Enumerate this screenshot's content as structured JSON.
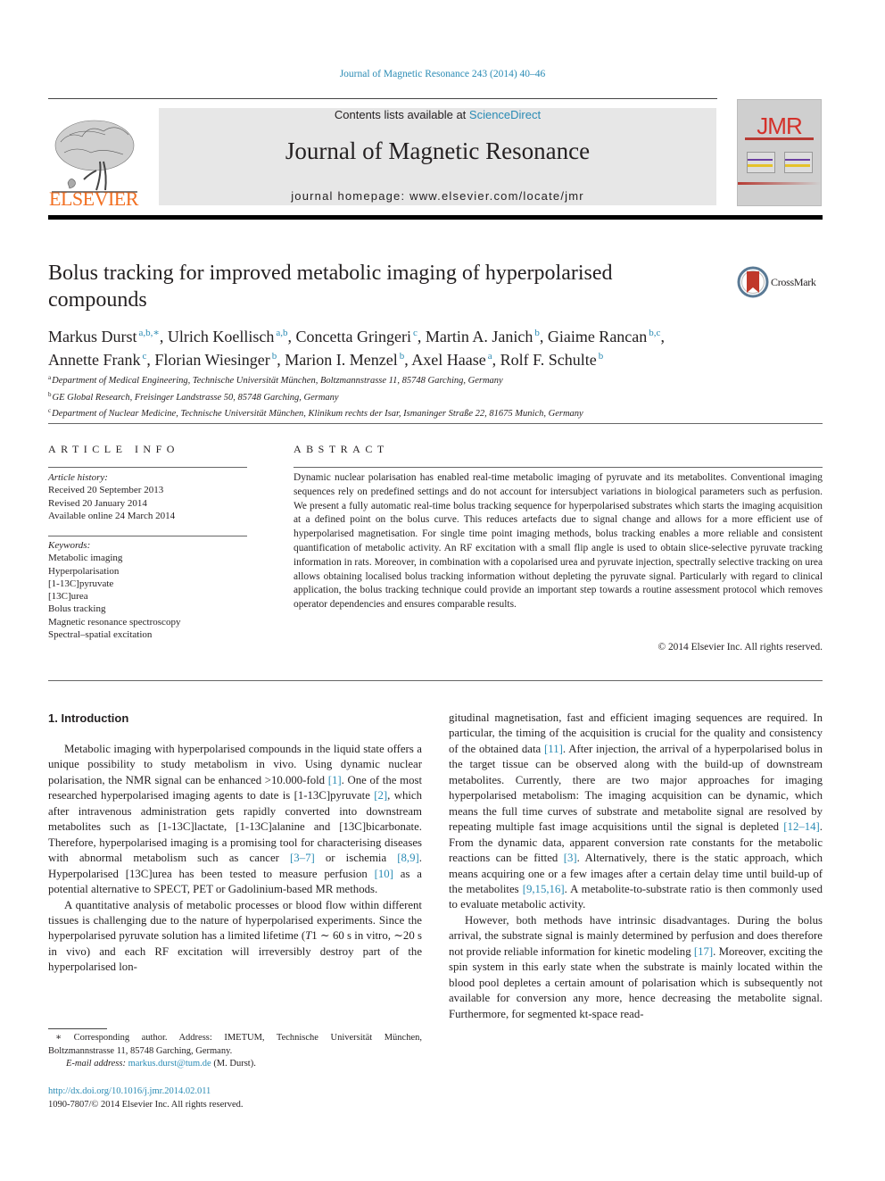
{
  "header": {
    "journal_reference": "Journal of Magnetic Resonance 243 (2014) 40–46",
    "publisher_logo_text": "ELSEVIER",
    "contents_prefix": "Contents lists available at ",
    "contents_link": "ScienceDirect",
    "journal_name": "Journal of Magnetic Resonance",
    "homepage": "journal homepage: www.elsevier.com/locate/jmr",
    "cover_title": "JMR",
    "colors": {
      "link": "#2a8bb4",
      "elsevier_orange": "#f26f21",
      "jmr_red": "#d4312a",
      "banner_bg": "#e7e7e7"
    }
  },
  "article": {
    "title": "Bolus tracking for improved metabolic imaging of hyperpolarised compounds",
    "crossmark_label": "CrossMark",
    "authors": [
      {
        "name": "Markus Durst",
        "sup": "a,b,∗",
        "sep": ", "
      },
      {
        "name": "Ulrich Koellisch",
        "sup": "a,b",
        "sep": ", "
      },
      {
        "name": "Concetta Gringeri",
        "sup": "c",
        "sep": ", "
      },
      {
        "name": "Martin A. Janich",
        "sup": "b",
        "sep": ", "
      },
      {
        "name": "Giaime Rancan",
        "sup": "b,c",
        "sep": ", "
      },
      {
        "name": "Annette Frank",
        "sup": "c",
        "sep": ", "
      },
      {
        "name": "Florian Wiesinger",
        "sup": "b",
        "sep": ", "
      },
      {
        "name": "Marion I. Menzel",
        "sup": "b",
        "sep": ", "
      },
      {
        "name": "Axel Haase",
        "sup": "a",
        "sep": ", "
      },
      {
        "name": "Rolf F. Schulte",
        "sup": "b",
        "sep": ""
      }
    ],
    "affiliations": [
      {
        "key": "a",
        "text": "Department of Medical Engineering, Technische Universität München, Boltzmannstrasse 11, 85748 Garching, Germany"
      },
      {
        "key": "b",
        "text": "GE Global Research, Freisinger Landstrasse 50, 85748 Garching, Germany"
      },
      {
        "key": "c",
        "text": "Department of Nuclear Medicine, Technische Universität München, Klinikum rechts der Isar, Ismaninger Straße 22, 81675 Munich, Germany"
      }
    ]
  },
  "article_info": {
    "heading": "ARTICLE INFO",
    "history_label": "Article history:",
    "received": "Received 20 September 2013",
    "revised": "Revised 20 January 2014",
    "available": "Available online 24 March 2014",
    "keywords_label": "Keywords:",
    "keywords": [
      "Metabolic imaging",
      "Hyperpolarisation",
      "[1-13C]pyruvate",
      "[13C]urea",
      "Bolus tracking",
      "Magnetic resonance spectroscopy",
      "Spectral–spatial excitation"
    ]
  },
  "abstract": {
    "heading": "ABSTRACT",
    "text": "Dynamic nuclear polarisation has enabled real-time metabolic imaging of pyruvate and its metabolites. Conventional imaging sequences rely on predefined settings and do not account for intersubject variations in biological parameters such as perfusion. We present a fully automatic real-time bolus tracking sequence for hyperpolarised substrates which starts the imaging acquisition at a defined point on the bolus curve. This reduces artefacts due to signal change and allows for a more efficient use of hyperpolarised magnetisation. For single time point imaging methods, bolus tracking enables a more reliable and consistent quantification of metabolic activity. An RF excitation with a small flip angle is used to obtain slice-selective pyruvate tracking information in rats. Moreover, in combination with a copolarised urea and pyruvate injection, spectrally selective tracking on urea allows obtaining localised bolus tracking information without depleting the pyruvate signal. Particularly with regard to clinical application, the bolus tracking technique could provide an important step towards a routine assessment protocol which removes operator dependencies and ensures comparable results.",
    "copyright": "© 2014 Elsevier Inc. All rights reserved."
  },
  "introduction": {
    "heading": "1. Introduction",
    "left_paragraphs": [
      [
        {
          "t": "Metabolic imaging with hyperpolarised compounds in the liquid state offers a unique possibility to study metabolism in vivo. Using dynamic nuclear polarisation, the NMR signal can be enhanced >10.000-fold "
        },
        {
          "ref": "[1]"
        },
        {
          "t": ". One of the most researched hyperpolarised imaging agents to date is [1-13C]pyruvate "
        },
        {
          "ref": "[2]"
        },
        {
          "t": ", which after intravenous administration gets rapidly converted into downstream metabolites such as [1-13C]lactate, [1-13C]alanine and [13C]bicarbonate. Therefore, hyperpolarised imaging is a promising tool for characterising diseases with abnormal metabolism such as cancer "
        },
        {
          "ref": "[3–7]"
        },
        {
          "t": " or ischemia "
        },
        {
          "ref": "[8,9]"
        },
        {
          "t": ". Hyperpolarised [13C]urea has been tested to measure perfusion "
        },
        {
          "ref": "[10]"
        },
        {
          "t": " as a potential alternative to SPECT, PET or Gadolinium-based MR methods."
        }
      ],
      [
        {
          "t": "A quantitative analysis of metabolic processes or blood flow within different tissues is challenging due to the nature of hyperpolarised experiments. Since the hyperpolarised pyruvate solution has a limited lifetime ("
        },
        {
          "i": "T"
        },
        {
          "t": "1 ∼ 60 s in vitro, ∼20 s in vivo) and each RF excitation will irreversibly destroy part of the hyperpolarised lon-"
        }
      ]
    ],
    "right_paragraphs": [
      [
        {
          "t": "gitudinal magnetisation, fast and efficient imaging sequences are required. In particular, the timing of the acquisition is crucial for the quality and consistency of the obtained data "
        },
        {
          "ref": "[11]"
        },
        {
          "t": ". After injection, the arrival of a hyperpolarised bolus in the target tissue can be observed along with the build-up of downstream metabolites. Currently, there are two major approaches for imaging hyperpolarised metabolism: The imaging acquisition can be dynamic, which means the full time curves of substrate and metabolite signal are resolved by repeating multiple fast image acquisitions until the signal is depleted "
        },
        {
          "ref": "[12–14]"
        },
        {
          "t": ". From the dynamic data, apparent conversion rate constants for the metabolic reactions can be fitted "
        },
        {
          "ref": "[3]"
        },
        {
          "t": ". Alternatively, there is the static approach, which means acquiring one or a few images after a certain delay time until build-up of the metabolites "
        },
        {
          "ref": "[9,15,16]"
        },
        {
          "t": ". A metabolite-to-substrate ratio is then commonly used to evaluate metabolic activity."
        }
      ],
      [
        {
          "t": "However, both methods have intrinsic disadvantages. During the bolus arrival, the substrate signal is mainly determined by perfusion and does therefore not provide reliable information for kinetic modeling "
        },
        {
          "ref": "[17]"
        },
        {
          "t": ". Moreover, exciting the spin system in this early state when the substrate is mainly located within the blood pool depletes a certain amount of polarisation which is subsequently not available for conversion any more, hence decreasing the metabolite signal. Furthermore, for segmented kt-space read-"
        }
      ]
    ]
  },
  "footnotes": {
    "corresponding": "∗ Corresponding author. Address: IMETUM, Technische Universität München, Boltzmannstrasse 11, 85748 Garching, Germany.",
    "email_label": "E-mail address: ",
    "email": "markus.durst@tum.de",
    "email_suffix": " (M. Durst).",
    "doi": "http://dx.doi.org/10.1016/j.jmr.2014.02.011",
    "issn_copyright": "1090-7807/© 2014 Elsevier Inc. All rights reserved."
  }
}
